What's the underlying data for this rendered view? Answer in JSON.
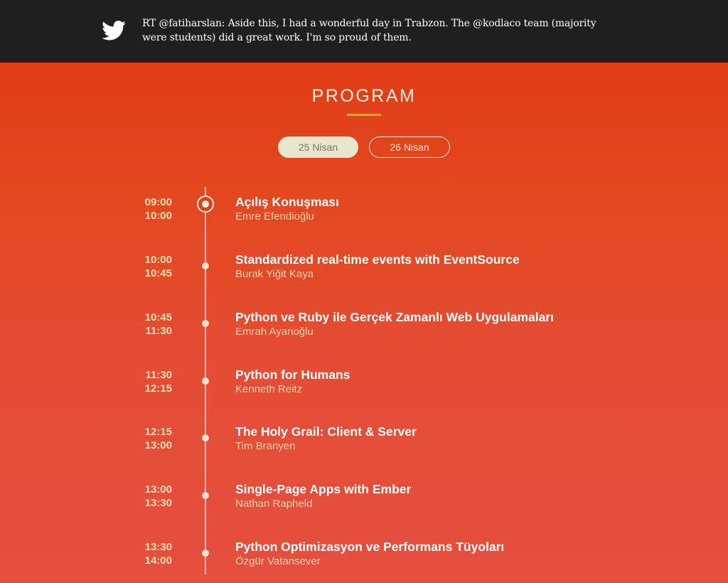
{
  "tweet": {
    "icon": "twitter-bird-icon",
    "text": "RT @fatiharslan: Aside this, I had a wonderful day in Trabzon. The @kodlaco team (majority were students) did a great work. I'm so proud of them."
  },
  "program": {
    "title": "PROGRAM",
    "tabs": [
      {
        "label": "25 Nisan",
        "active": true
      },
      {
        "label": "26 Nisan",
        "active": false
      }
    ],
    "sessions": [
      {
        "start": "09:00",
        "end": "10:00",
        "title": "Açılış Konuşması",
        "speaker": "Emre Efendioğlu"
      },
      {
        "start": "10:00",
        "end": "10:45",
        "title": "Standardized real-time events with EventSource",
        "speaker": "Burak Yiğit Kaya"
      },
      {
        "start": "10:45",
        "end": "11:30",
        "title": "Python ve Ruby ile Gerçek Zamanlı Web Uygulamaları",
        "speaker": "Emrah Ayanoğlu"
      },
      {
        "start": "11:30",
        "end": "12:15",
        "title": "Python for Humans",
        "speaker": "Kenneth Reitz"
      },
      {
        "start": "12:15",
        "end": "13:00",
        "title": "The Holy Grail: Client & Server",
        "speaker": "Tim Branyen"
      },
      {
        "start": "13:00",
        "end": "13:30",
        "title": "Single-Page Apps with Ember",
        "speaker": "Nathan Rapheld"
      },
      {
        "start": "13:30",
        "end": "14:00",
        "title": "Python Optimizasyon ve Performans Tüyoları",
        "speaker": "Özgür Vatansever"
      }
    ]
  },
  "colors": {
    "tweet_bar_bg": "#1f1f1f",
    "program_bg": "#e5472f",
    "accent_underline": "#f7a033",
    "time_text": "#f9dfb4",
    "speaker_text": "#f9d2a9",
    "active_tab_bg": "#e8e6cf"
  }
}
